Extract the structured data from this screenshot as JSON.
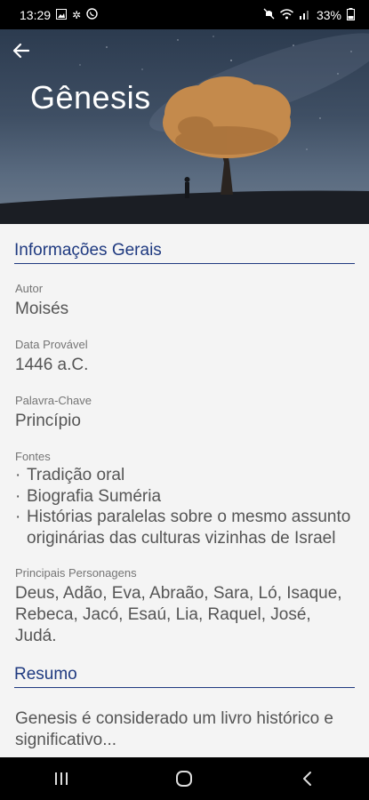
{
  "status_bar": {
    "time": "13:29",
    "battery": "33%",
    "left_icons": [
      "gallery-icon",
      "pinwheel-icon",
      "whatsapp-icon"
    ],
    "right_icons": [
      "mute-icon",
      "wifi-icon",
      "signal-icon",
      "battery-icon"
    ]
  },
  "hero": {
    "title": "Gênesis",
    "back_icon": "arrow-left-icon"
  },
  "info_section": {
    "title": "Informações Gerais",
    "author_label": "Autor",
    "author_value": "Moisés",
    "date_label": "Data Provável",
    "date_value": "1446 a.C.",
    "keyword_label": "Palavra-Chave",
    "keyword_value": "Princípio",
    "sources_label": "Fontes",
    "sources": [
      "Tradição oral",
      "Biografia Suméria",
      "Histórias paralelas sobre o mesmo assunto originárias das culturas vizinhas de Israel"
    ],
    "characters_label": "Principais Personagens",
    "characters_value": "Deus, Adão, Eva, Abraão, Sara, Ló, Isaque, Rebeca, Jacó, Esaú, Lia, Raquel, José, Judá."
  },
  "summary_section": {
    "title": "Resumo",
    "text": "Genesis é considerado um livro histórico e significativo..."
  },
  "nav_bar": {
    "recents_icon": "recents-icon",
    "home_icon": "home-icon",
    "back_icon": "back-chevron-icon"
  },
  "colors": {
    "accent": "#1f3a80",
    "text": "#555555",
    "label": "#757575",
    "background": "#f4f4f4"
  }
}
